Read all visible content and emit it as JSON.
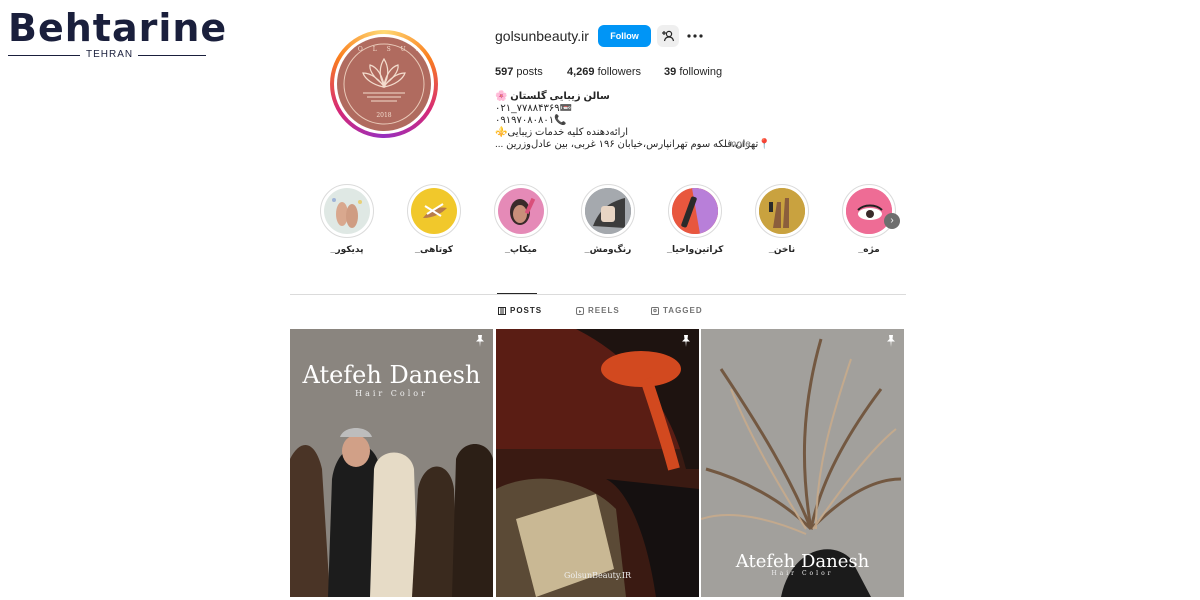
{
  "watermark": {
    "brand": "Behtarine",
    "city": "TEHRAN"
  },
  "profile": {
    "username": "golsunbeauty.ir",
    "follow_label": "Follow",
    "avatar_brand_text": "G O L S U N",
    "avatar_year": "2018",
    "stats": [
      {
        "count": "597",
        "label": "posts"
      },
      {
        "count": "4,269",
        "label": "followers"
      },
      {
        "count": "39",
        "label": "following"
      }
    ],
    "bio": {
      "name": "سالن زیبایی گلستان 🌸",
      "phone1": "۰۲۱_۷۷۸۸۴۳۶۹📼",
      "phone2": "۰۹۱۹۷۰۸۰۸۰۱📞",
      "services": "ارائه‌دهنده کلیه خدمات زیبایی⚜️",
      "address": "📍تهران،فلکه سوم تهرانپارس،خیابان ۱۹۶ غربی، بین عادل‌وزرین ...",
      "more_label": "more"
    }
  },
  "highlights": [
    {
      "label": "_پدیکور",
      "icon": "feet-pedicure"
    },
    {
      "label": "_کوتاهی",
      "icon": "hair-cut"
    },
    {
      "label": "_میکاپ",
      "icon": "makeup"
    },
    {
      "label": "_رنگ‌ومش",
      "icon": "hair-color"
    },
    {
      "label": "_کراتین‌واحیا",
      "icon": "keratin"
    },
    {
      "label": "_ناخن",
      "icon": "nails"
    },
    {
      "label": "_مژه",
      "icon": "eyelash"
    }
  ],
  "tabs": [
    {
      "label": "POSTS",
      "icon": "grid-icon",
      "active": true
    },
    {
      "label": "REELS",
      "icon": "reels-icon",
      "active": false
    },
    {
      "label": "TAGGED",
      "icon": "tag-icon",
      "active": false
    }
  ],
  "posts": [
    {
      "title": "Atefeh Danesh",
      "subtitle": "Hair Color",
      "pinned": true
    },
    {
      "caption": "GolsunBeauty.IR",
      "pinned": true
    },
    {
      "title": "Atefeh Danesh",
      "subtitle": "Hair Color",
      "pinned": true
    }
  ],
  "colors": {
    "accent": "#0095f6",
    "text": "#262626",
    "muted": "#737373",
    "avatar": "#b06b5f"
  }
}
